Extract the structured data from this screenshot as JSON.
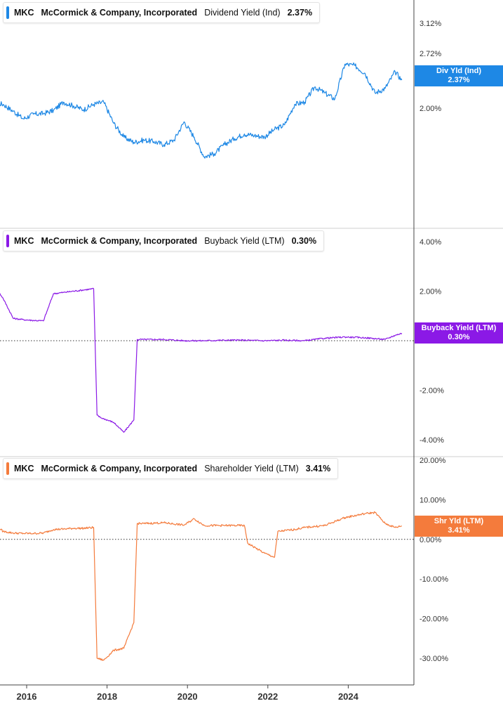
{
  "ticker": "MKC",
  "company": "McCormick & Company, Incorporated",
  "x_axis_labels": [
    "2016",
    "2018",
    "2020",
    "2022",
    "2024"
  ],
  "chart_data": [
    {
      "type": "line",
      "metric": "Dividend Yield (Ind)",
      "legend_value": "2.37%",
      "tag_label": "Div Yld (Ind)",
      "tag_value": "2.37%",
      "color": "#1e88e5",
      "y_ticks": [
        "3.12%",
        "2.72%",
        "2.00%"
      ],
      "x": [
        "2015-03",
        "2015-06",
        "2015-09",
        "2015-12",
        "2016-03",
        "2016-06",
        "2016-09",
        "2016-12",
        "2017-03",
        "2017-06",
        "2017-09",
        "2017-12",
        "2018-03",
        "2018-06",
        "2018-09",
        "2018-12",
        "2019-03",
        "2019-06",
        "2019-09",
        "2019-12",
        "2020-03",
        "2020-06",
        "2020-09",
        "2020-12",
        "2021-03",
        "2021-06",
        "2021-09",
        "2021-12",
        "2022-03",
        "2022-06",
        "2022-09",
        "2022-12",
        "2023-03",
        "2023-06",
        "2023-09",
        "2023-12",
        "2024-03",
        "2024-06",
        "2024-09",
        "2024-12",
        "2025-03",
        "2025-05"
      ],
      "y": [
        2.08,
        2.05,
        1.96,
        1.86,
        1.92,
        1.93,
        1.97,
        2.08,
        2.03,
        1.98,
        2.05,
        2.08,
        1.8,
        1.62,
        1.55,
        1.58,
        1.56,
        1.52,
        1.58,
        1.82,
        1.62,
        1.36,
        1.4,
        1.52,
        1.6,
        1.66,
        1.64,
        1.62,
        1.72,
        1.78,
        2.05,
        2.08,
        2.28,
        2.2,
        2.12,
        2.58,
        2.56,
        2.46,
        2.2,
        2.26,
        2.48,
        2.37
      ]
    },
    {
      "type": "line",
      "metric": "Buyback Yield (LTM)",
      "legend_value": "0.30%",
      "tag_label": "Buyback Yield (LTM)",
      "tag_value": "0.30%",
      "color": "#8b19e6",
      "y_ticks": [
        "4.00%",
        "2.00%",
        "0.00%",
        "-2.00%",
        "-4.00%"
      ],
      "x": [
        "2015-03",
        "2015-06",
        "2015-09",
        "2015-12",
        "2016-03",
        "2016-06",
        "2016-09",
        "2016-12",
        "2017-03",
        "2017-06",
        "2017-09",
        "2017-10",
        "2017-11",
        "2018-03",
        "2018-06",
        "2018-09",
        "2018-10",
        "2018-12",
        "2019-06",
        "2019-12",
        "2020-06",
        "2020-12",
        "2021-06",
        "2021-12",
        "2022-06",
        "2022-12",
        "2023-06",
        "2023-12",
        "2024-06",
        "2024-12",
        "2025-03",
        "2025-05"
      ],
      "y": [
        2.3,
        1.7,
        0.9,
        0.85,
        0.82,
        0.8,
        1.9,
        1.95,
        2.0,
        2.05,
        2.1,
        -3.0,
        -3.1,
        -3.3,
        -3.7,
        -3.2,
        0.05,
        0.05,
        0.05,
        0.0,
        0.0,
        0.02,
        0.02,
        0.0,
        0.02,
        0.0,
        0.1,
        0.15,
        0.12,
        0.05,
        0.22,
        0.3
      ]
    },
    {
      "type": "line",
      "metric": "Shareholder Yield (LTM)",
      "legend_value": "3.41%",
      "tag_label": "Shr Yld (LTM)",
      "tag_value": "3.41%",
      "color": "#f47b3c",
      "y_ticks": [
        "20.00%",
        "10.00%",
        "0.00%",
        "-10.00%",
        "-20.00%",
        "-30.00%"
      ],
      "x": [
        "2015-03",
        "2015-06",
        "2015-09",
        "2015-12",
        "2016-03",
        "2016-06",
        "2016-09",
        "2016-12",
        "2017-03",
        "2017-06",
        "2017-09",
        "2017-10",
        "2017-12",
        "2018-03",
        "2018-06",
        "2018-09",
        "2018-10",
        "2018-12",
        "2019-06",
        "2019-12",
        "2020-03",
        "2020-06",
        "2020-12",
        "2021-06",
        "2021-07",
        "2021-12",
        "2022-03",
        "2022-04",
        "2022-09",
        "2022-12",
        "2023-06",
        "2023-12",
        "2024-06",
        "2024-09",
        "2024-12",
        "2025-03",
        "2025-05"
      ],
      "y": [
        4.0,
        2.0,
        1.6,
        1.5,
        1.5,
        1.6,
        2.5,
        2.6,
        2.8,
        2.8,
        3.0,
        -30.0,
        -30.5,
        -28.0,
        -27.5,
        -21.0,
        4.0,
        4.0,
        4.2,
        3.6,
        5.2,
        3.5,
        3.5,
        3.5,
        -1.0,
        -3.5,
        -4.5,
        2.0,
        2.5,
        3.0,
        3.5,
        5.5,
        6.5,
        6.8,
        4.0,
        3.0,
        3.41
      ]
    }
  ]
}
